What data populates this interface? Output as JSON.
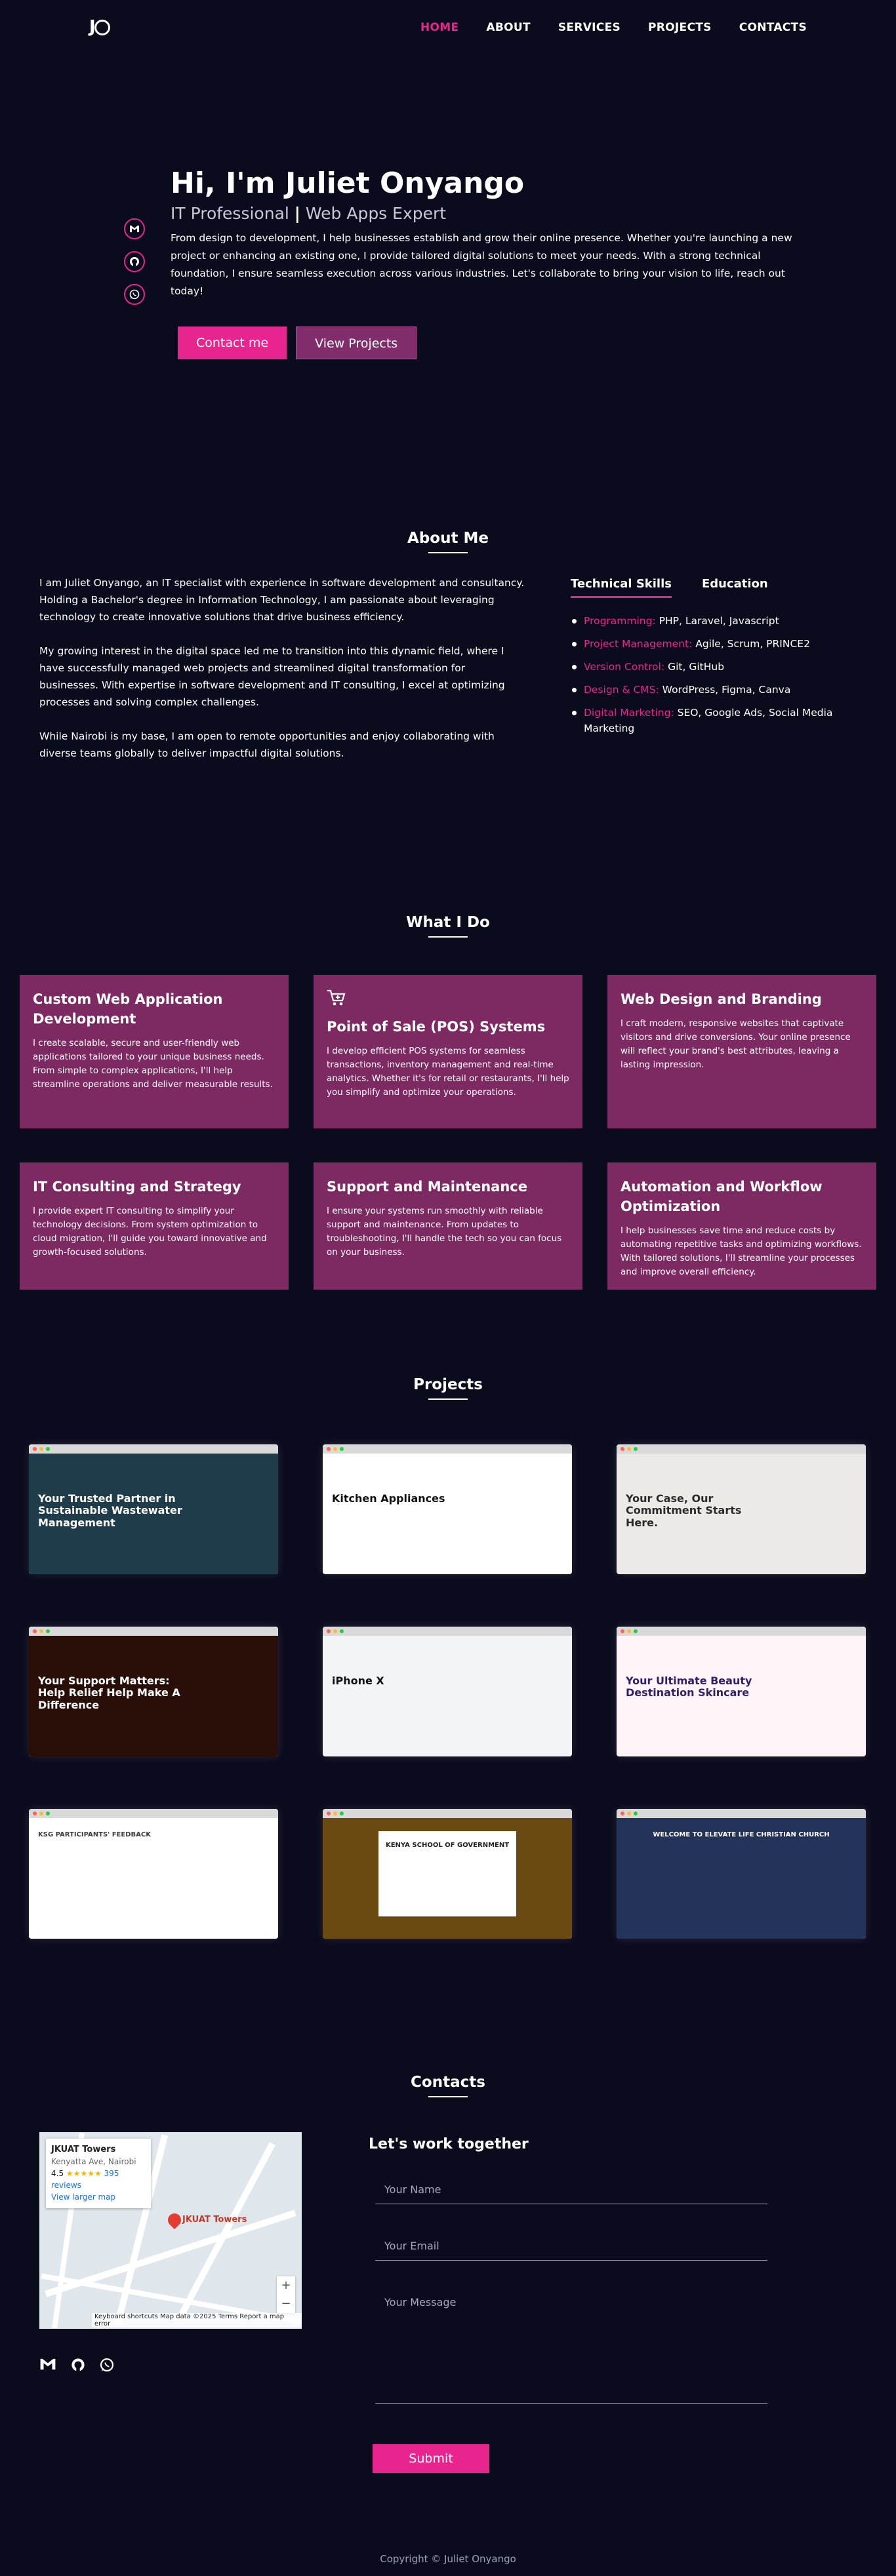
{
  "nav": {
    "links": [
      "HOME",
      "ABOUT",
      "SERVICES",
      "PROJECTS",
      "CONTACTS"
    ]
  },
  "hero": {
    "heading": "Hi, I'm Juliet Onyango",
    "role_a": "IT Professional",
    "role_sep": "|",
    "role_b": "Web Apps Expert",
    "intro": "From design to development, I help businesses establish and grow their online presence. Whether you're launching a new project or enhancing an existing one, I provide tailored digital solutions to meet your needs. With a strong technical foundation, I ensure seamless execution across various industries. Let's collaborate to bring your vision to life, reach out today!",
    "btn_contact": "Contact me",
    "btn_projects": "View Projects"
  },
  "about": {
    "title": "About Me",
    "p1": "I am Juliet Onyango, an IT specialist with experience in software development and consultancy. Holding a Bachelor's degree in Information Technology, I am passionate about leveraging technology to create innovative solutions that drive business efficiency.",
    "p2": "My growing interest in the digital space led me to transition into this dynamic field, where I have successfully managed web projects and streamlined digital transformation for businesses. With expertise in software development and IT consulting, I excel at optimizing processes and solving complex challenges.",
    "p3": "While Nairobi is my base, I am open to remote opportunities and enjoy collaborating with diverse teams globally to deliver impactful digital solutions.",
    "tabs": [
      "Technical Skills",
      "Education"
    ],
    "skills": [
      {
        "k": "Programming:",
        "v": " PHP, Laravel, Javascript"
      },
      {
        "k": "Project Management:",
        "v": " Agile, Scrum, PRINCE2"
      },
      {
        "k": "Version Control:",
        "v": " Git, GitHub"
      },
      {
        "k": "Design & CMS:",
        "v": " WordPress, Figma, Canva"
      },
      {
        "k": "Digital Marketing:",
        "v": " SEO, Google Ads, Social Media Marketing"
      }
    ]
  },
  "services": {
    "title": "What I Do",
    "items": [
      {
        "title": "Custom Web Application Development",
        "desc": "I create scalable, secure and user-friendly web applications tailored to your unique business needs. From simple to complex applications, I'll help streamline operations and deliver measurable results."
      },
      {
        "title": "Point of Sale (POS) Systems",
        "desc": "I develop efficient POS systems for seamless transactions, inventory management and real-time analytics. Whether it's for retail or restaurants, I'll help you simplify and optimize your operations."
      },
      {
        "title": "Web Design and Branding",
        "desc": "I craft modern, responsive websites that captivate visitors and drive conversions. Your online presence will reflect your brand's best attributes, leaving a lasting impression."
      },
      {
        "title": "IT Consulting and Strategy",
        "desc": "I provide expert IT consulting to simplify your technology decisions. From system optimization to cloud migration, I'll guide you toward innovative and growth-focused solutions."
      },
      {
        "title": "Support and Maintenance",
        "desc": "I ensure your systems run smoothly with reliable support and maintenance. From updates to troubleshooting, I'll handle the tech so you can focus on your business."
      },
      {
        "title": "Automation and Workflow Optimization",
        "desc": "I help businesses save time and reduce costs by automating repetitive tasks and optimizing workflows. With tailored solutions, I'll streamline your processes and improve overall efficiency."
      }
    ]
  },
  "projects": {
    "title": "Projects",
    "shots": [
      {
        "headline": "Your Trusted Partner in Sustainable Wastewater Management",
        "bg": "#1f3c4a",
        "fg": "#ffffff"
      },
      {
        "headline": "Kitchen Appliances",
        "bg": "#ffffff",
        "fg": "#111111"
      },
      {
        "headline": "Your Case, Our Commitment Starts Here.",
        "bg": "#eceae6",
        "fg": "#2a2a2a"
      },
      {
        "headline": "Your Support Matters: Help Relief Help Make A Difference",
        "bg": "#2a0f08",
        "fg": "#ffffff"
      },
      {
        "headline": "iPhone X",
        "bg": "#f3f4f7",
        "fg": "#111111"
      },
      {
        "headline": "Your Ultimate Beauty Destination Skincare",
        "bg": "#fff4f8",
        "fg": "#30206a"
      },
      {
        "headline": "KSG PARTICIPANTS' FEEDBACK",
        "bg": "#ffffff",
        "fg": "#3b3b3b"
      },
      {
        "headline": "KENYA SCHOOL OF GOVERNMENT",
        "bg": "#6b4a12",
        "fg": "#222222"
      },
      {
        "headline": "WELCOME TO ELEVATE LIFE CHRISTIAN CHURCH",
        "bg": "#24335a",
        "fg": "#ffffff"
      }
    ]
  },
  "contacts": {
    "title": "Contacts",
    "form_title": "Let's work together",
    "name_placeholder": "Your Name",
    "email_placeholder": "Your Email",
    "message_placeholder": "Your Message",
    "submit": "Submit",
    "map": {
      "place": "JKUAT Towers",
      "address": "Kenyatta Ave, Nairobi",
      "rating": "4.5",
      "stars": "★★★★★",
      "reviews": "395 reviews",
      "larger": "View larger map",
      "pin_label": "JKUAT Towers",
      "attribution": "Keyboard shortcuts   Map data ©2025   Terms   Report a map error"
    }
  },
  "footer": {
    "copyright": "Copyright © Juliet Onyango"
  },
  "colors": {
    "background": "#0a0b1d",
    "accent": "#e8248f",
    "card": "#7d2a63"
  }
}
